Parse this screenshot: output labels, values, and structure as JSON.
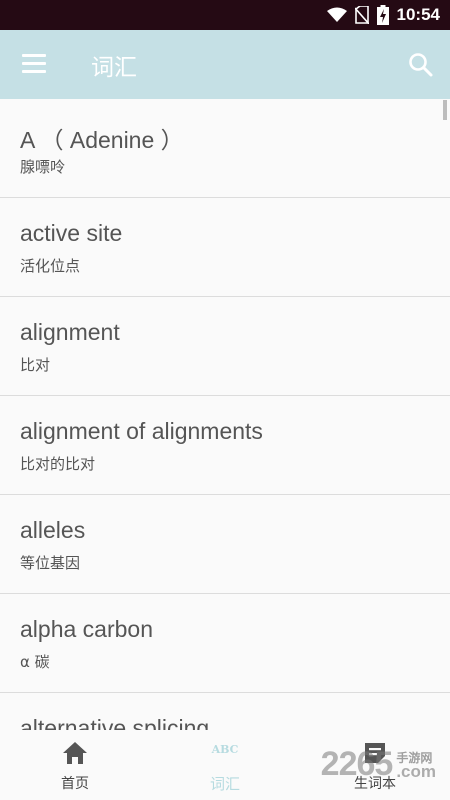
{
  "status_bar": {
    "time": "10:54"
  },
  "app_bar": {
    "title": "词汇"
  },
  "vocab_list": [
    {
      "term": "A （ Adenine ）",
      "translation": "腺嘌呤"
    },
    {
      "term": "active site",
      "translation": "活化位点"
    },
    {
      "term": "alignment",
      "translation": "比对"
    },
    {
      "term": "alignment of alignments",
      "translation": "比对的比对"
    },
    {
      "term": "alleles",
      "translation": "等位基因"
    },
    {
      "term": "alpha carbon",
      "translation": "α 碳"
    },
    {
      "term": "alternative splicing",
      "translation": ""
    }
  ],
  "bottom_nav": {
    "items": [
      {
        "label": "首页",
        "icon": "home-icon",
        "active": false
      },
      {
        "label": "词汇",
        "icon": "abc-icon",
        "icon_text": "ABC",
        "active": true
      },
      {
        "label": "生词本",
        "icon": "notebook-icon",
        "active": false
      }
    ]
  },
  "watermark": {
    "number": "2265",
    "cn": "手游网",
    "suffix": ".com"
  },
  "colors": {
    "app_bar": "#c5e0e5",
    "status_bar": "#250a14",
    "active_tab": "#b6dbe0"
  }
}
